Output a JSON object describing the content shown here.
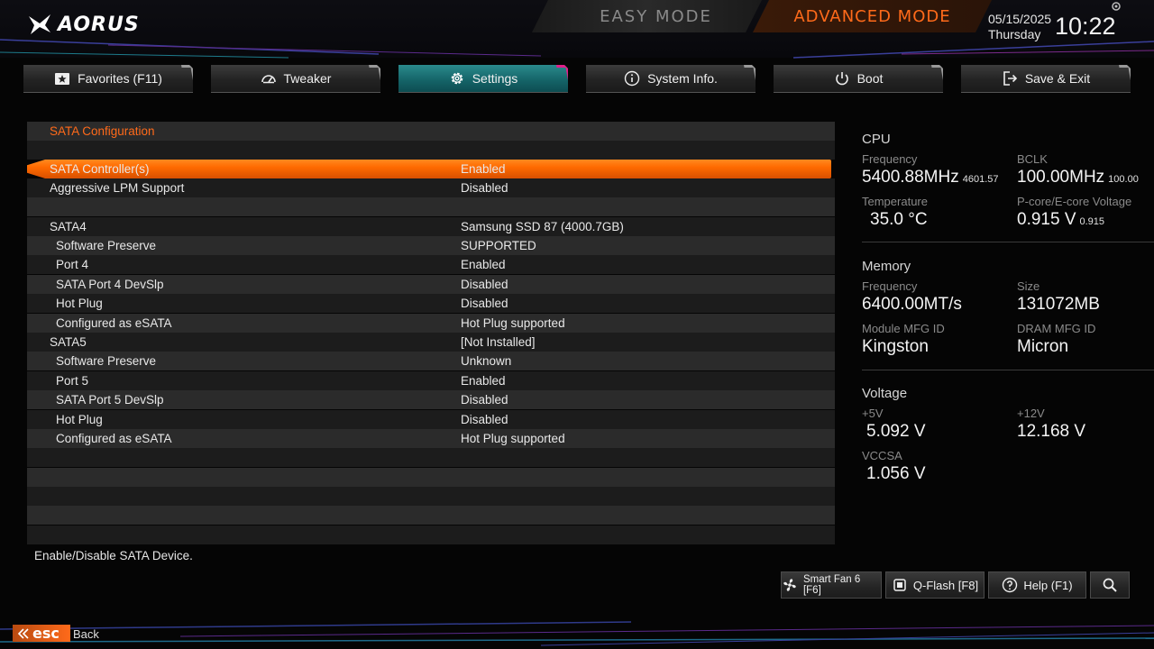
{
  "header": {
    "logo": "AORUS",
    "easy_mode": "EASY MODE",
    "advanced_mode": "ADVANCED MODE",
    "date": "05/15/2025",
    "day": "Thursday",
    "time": "10:22"
  },
  "tabs": [
    {
      "label": "Favorites (F11)",
      "icon": "star-folder-icon"
    },
    {
      "label": "Tweaker",
      "icon": "speedometer-icon"
    },
    {
      "label": "Settings",
      "icon": "gear-icon"
    },
    {
      "label": "System Info.",
      "icon": "info-icon"
    },
    {
      "label": "Boot",
      "icon": "power-icon"
    },
    {
      "label": "Save & Exit",
      "icon": "exit-icon"
    }
  ],
  "active_tab": "Settings",
  "settings": {
    "section_title": "SATA Configuration",
    "rows": [
      {
        "name": "SATA Controller(s)",
        "value": "Enabled"
      },
      {
        "name": "Aggressive LPM Support",
        "value": "Disabled"
      },
      {
        "name": "SATA4",
        "value": "Samsung SSD 87 (4000.7GB)"
      },
      {
        "name": "Software Preserve",
        "value": "SUPPORTED"
      },
      {
        "name": "Port 4",
        "value": "Enabled"
      },
      {
        "name": "SATA Port 4 DevSlp",
        "value": "Disabled"
      },
      {
        "name": "Hot Plug",
        "value": "Disabled"
      },
      {
        "name": "Configured as eSATA",
        "value": "Hot Plug supported"
      },
      {
        "name": "SATA5",
        "value": "[Not Installed]"
      },
      {
        "name": "Software Preserve",
        "value": "Unknown"
      },
      {
        "name": "Port 5",
        "value": "Enabled"
      },
      {
        "name": "SATA Port 5 DevSlp",
        "value": "Disabled"
      },
      {
        "name": "Hot Plug",
        "value": "Disabled"
      },
      {
        "name": "Configured as eSATA",
        "value": "Hot Plug supported"
      }
    ]
  },
  "help_text": "Enable/Disable SATA Device.",
  "info_panel": {
    "cpu": {
      "title": "CPU",
      "frequency_label": "Frequency",
      "frequency": "5400.88MHz",
      "frequency_sub": "4601.57",
      "bclk_label": "BCLK",
      "bclk": "100.00MHz",
      "bclk_sub": "100.00",
      "temperature_label": "Temperature",
      "temperature": "35.0 °C",
      "voltage_label": "P-core/E-core Voltage",
      "voltage": "0.915 V",
      "voltage_sub": "0.915"
    },
    "memory": {
      "title": "Memory",
      "frequency_label": "Frequency",
      "frequency": "6400.00MT/s",
      "size_label": "Size",
      "size": "131072MB",
      "module_label": "Module MFG ID",
      "module": "Kingston",
      "dram_label": "DRAM MFG ID",
      "dram": "Micron"
    },
    "voltage": {
      "title": "Voltage",
      "v5_label": "+5V",
      "v5": "5.092 V",
      "v12_label": "+12V",
      "v12": "12.168 V",
      "vccsa_label": "VCCSA",
      "vccsa": "1.056 V"
    }
  },
  "bottom_buttons": {
    "smart_fan": "Smart Fan 6 [F6]",
    "qflash": "Q-Flash [F8]",
    "help": "Help (F1)"
  },
  "esc": {
    "key": "esc",
    "label": "Back"
  },
  "colors": {
    "accent_orange": "#ff6a1a",
    "active_tab_teal": "#146266",
    "active_tab_edge": "#e0208a",
    "row_light": "#2b2b2b",
    "row_dark": "#1c1c1c"
  }
}
